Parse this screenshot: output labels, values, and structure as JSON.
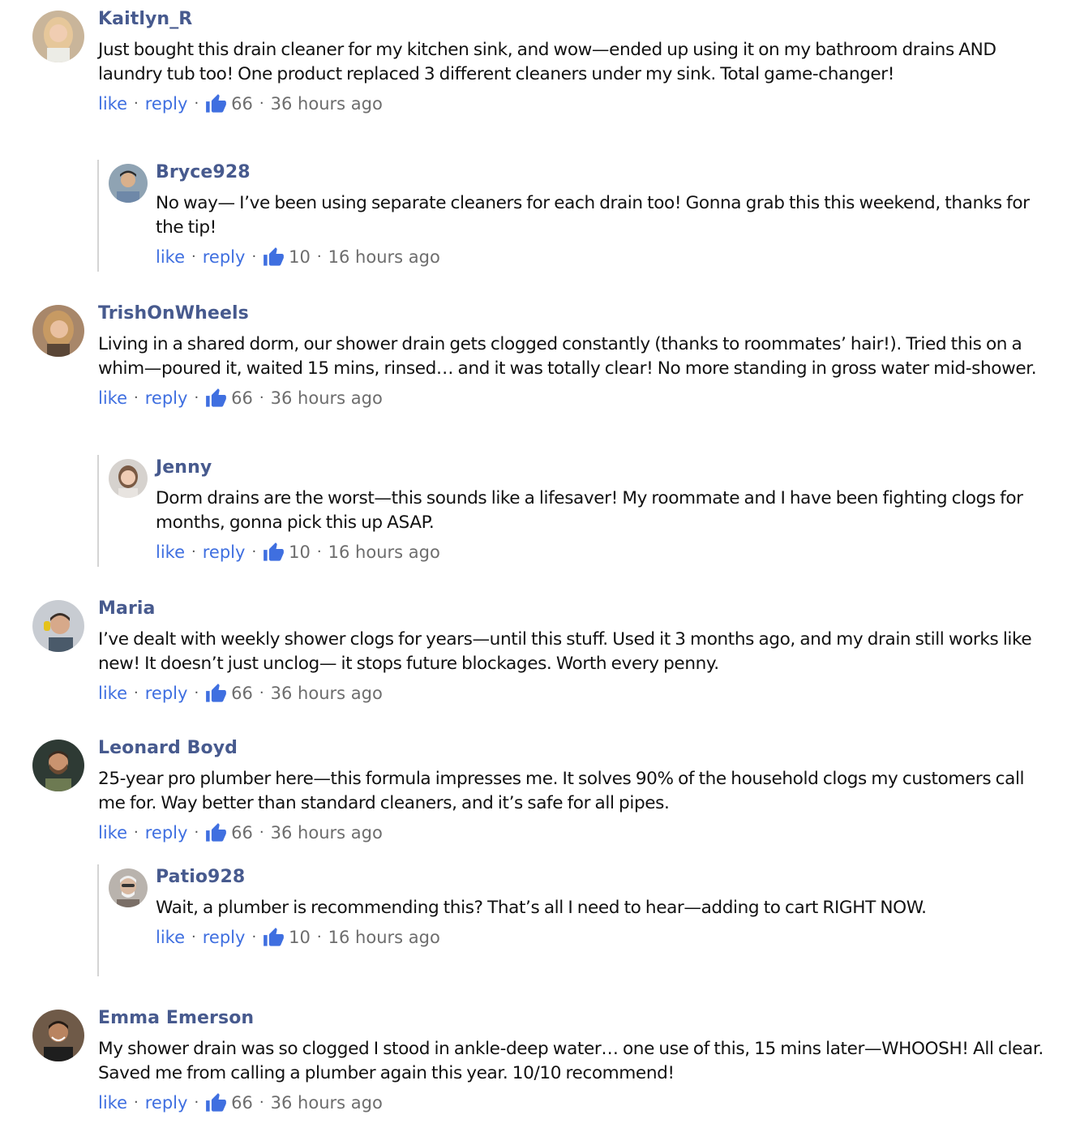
{
  "comments": [
    {
      "name": "Kaitlyn_R",
      "text": "Just bought this drain cleaner for my kitchen sink, and wow—ended up using it on my bathroom drains AND laundry tub too! One product replaced 3 different cleaners under my sink. Total game-changer!",
      "like": "like",
      "reply": "reply",
      "likes": "66",
      "time": "36 hours ago",
      "replies": [
        {
          "name": "Bryce928",
          "text": "No way— I’ve been using separate cleaners for each drain too! Gonna grab this this weekend, thanks for the tip!",
          "like": "like",
          "reply": "reply",
          "likes": "10",
          "time": "16 hours ago"
        }
      ]
    },
    {
      "name": "TrishOnWheels",
      "text": "Living in a shared dorm, our shower drain gets clogged constantly (thanks to roommates’ hair!). Tried this on a whim—poured it, waited 15 mins, rinsed… and it was totally clear! No more standing in gross water mid-shower.",
      "like": "like",
      "reply": "reply",
      "likes": "66",
      "time": "36 hours ago",
      "replies": [
        {
          "name": "Jenny",
          "text": "Dorm drains are the worst—this sounds like a lifesaver! My roommate and I have been fighting clogs for months, gonna pick this up ASAP.",
          "like": "like",
          "reply": "reply",
          "likes": "10",
          "time": "16 hours ago"
        }
      ]
    },
    {
      "name": "Maria",
      "text": "I’ve dealt with weekly shower clogs for years—until this stuff. Used it 3 months ago, and my drain still works like new! It doesn’t just unclog— it stops future blockages. Worth every penny.",
      "like": "like",
      "reply": "reply",
      "likes": "66",
      "time": "36 hours ago",
      "replies": []
    },
    {
      "name": "Leonard Boyd",
      "text": "25-year pro plumber here—this formula impresses me. It solves 90% of the household clogs my customers call me for. Way better than standard cleaners, and it’s safe for all pipes.",
      "like": "like",
      "reply": "reply",
      "likes": "66",
      "time": "36 hours ago",
      "replies": [
        {
          "name": "Patio928",
          "text": "Wait, a plumber is recommending this? That’s all I need to hear—adding to cart RIGHT NOW.",
          "like": "like",
          "reply": "reply",
          "likes": "10",
          "time": "16 hours ago"
        }
      ]
    },
    {
      "name": "Emma Emerson",
      "text": "My shower drain was so clogged I stood in ankle-deep water… one use of this, 15 mins later—WHOOSH! All clear. Saved me from calling a plumber again this year. 10/10 recommend!",
      "like": "like",
      "reply": "reply",
      "likes": "66",
      "time": "36 hours ago",
      "replies": []
    }
  ],
  "icons": {
    "thumb": "thumbs-up-icon",
    "avatar": "user-avatar"
  },
  "colors": {
    "name": "#475a8e",
    "link": "#3f6fe0",
    "thumb": "#3f6fe0",
    "meta": "#6d6d6d"
  }
}
